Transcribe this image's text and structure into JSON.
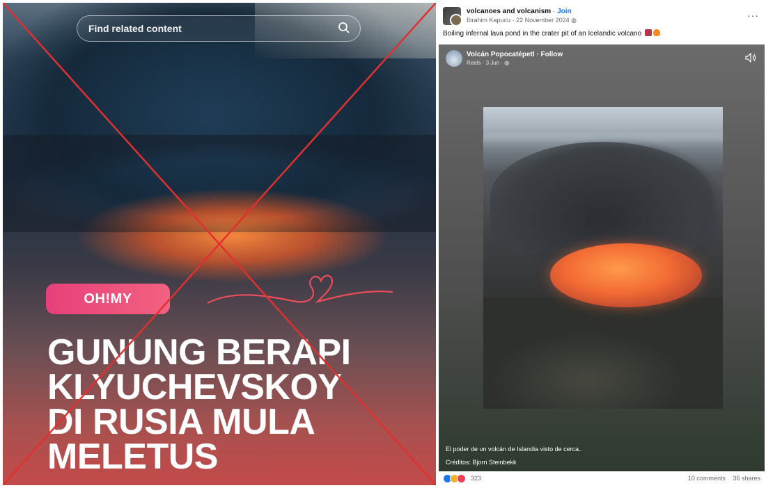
{
  "left_panel": {
    "search_placeholder": "Find related content",
    "badge": "OH!MY",
    "headline_lines": [
      "GUNUNG BERAPI",
      "KLYUCHEVSKOY",
      "DI RUSIA MULA",
      "MELETUS"
    ],
    "cross_color": "#e03030"
  },
  "post": {
    "group_name": "volcanoes and volcanism",
    "join_label": "Join",
    "author": "İbrahim Kapucu",
    "date": "22 November 2024",
    "caption": "Boiling infernal lava pond in the crater pit of an Icelandic volcano",
    "more_label": "···",
    "reel": {
      "page_name": "Volcán Popocatépetl",
      "follow_label": "Follow",
      "meta": "Reels · 3 Jun ·",
      "caption_line1": "El poder de un volcán de Islandia visto de cerca..",
      "caption_line2": "Créditos: Bjorn Steinbekk"
    },
    "reaction_count": "323",
    "comments": "10 comments",
    "shares": "36 shares"
  }
}
